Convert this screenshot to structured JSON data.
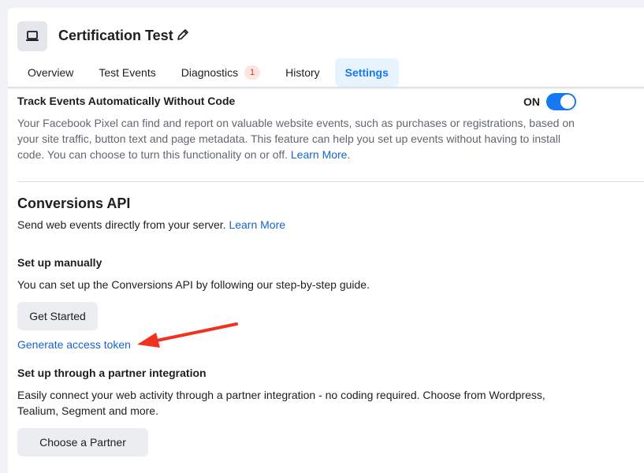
{
  "header": {
    "title": "Certification Test",
    "icon": "laptop-icon",
    "edit_icon": "pencil-icon"
  },
  "tabs": [
    {
      "label": "Overview"
    },
    {
      "label": "Test Events"
    },
    {
      "label": "Diagnostics",
      "badge": "1"
    },
    {
      "label": "History"
    },
    {
      "label": "Settings",
      "active": true
    }
  ],
  "track_events": {
    "heading": "Track Events Automatically Without Code",
    "toggle_label": "ON",
    "toggle_state": "on",
    "description": "Your Facebook Pixel can find and report on valuable website events, such as purchases or registrations, based on your site traffic, button text and page metadata. This feature can help you set up events without having to install code. You can choose to turn this functionality on or off. ",
    "learn_more": "Learn More",
    "period": "."
  },
  "conversions_api": {
    "heading": "Conversions API",
    "description": "Send web events directly from your server. ",
    "learn_more": "Learn More",
    "manual": {
      "heading": "Set up manually",
      "description": "You can set up the Conversions API by following our step-by-step guide.",
      "button": "Get Started",
      "token_link": "Generate access token"
    },
    "partner": {
      "heading": "Set up through a partner integration",
      "description": "Easily connect your web activity through a partner integration - no coding required. Choose from Wordpress, Tealium, Segment and more.",
      "button": "Choose a Partner"
    }
  },
  "colors": {
    "accent": "#1877f2",
    "link": "#1763cf",
    "annotation_arrow": "#f0321e"
  }
}
